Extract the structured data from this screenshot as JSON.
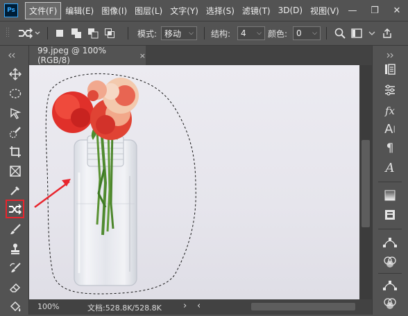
{
  "menubar": {
    "logo": "Ps",
    "items": [
      "文件(F)",
      "编辑(E)",
      "图像(I)",
      "图层(L)",
      "文字(Y)",
      "选择(S)",
      "滤镜(T)",
      "3D(D)",
      "视图(V)"
    ],
    "active_index": 0
  },
  "window_controls": {
    "minimize": "—",
    "restore": "❐",
    "close": "✕"
  },
  "options": {
    "mode_label": "模式:",
    "mode_value": "移动",
    "structure_label": "结构:",
    "structure_value": "4",
    "color_label": "颜色:",
    "color_value": "0"
  },
  "document": {
    "tab_title": "99.jpeg @ 100%(RGB/8)",
    "close": "×"
  },
  "status": {
    "zoom": "100%",
    "doc_info": "文档:528.8K/528.8K",
    "next": "›",
    "prev": "‹"
  },
  "colors": {
    "panel_bg": "#535353",
    "dark_bg": "#424242",
    "accent_red": "#e8252d",
    "ps_blue": "#31a8ff"
  },
  "tools_left": [
    "move-tool",
    "marquee-tool",
    "lasso-tool",
    "quick-selection-tool",
    "crop-tool",
    "frame-tool",
    "eyedropper-tool",
    "content-aware-move-tool",
    "brush-tool",
    "clone-stamp-tool",
    "history-brush-tool",
    "eraser-tool",
    "paint-bucket-tool",
    "blur-tool"
  ],
  "panels_right": [
    "history-icon",
    "adjustments-icon",
    "fx-styles-icon",
    "character-icon",
    "paragraph-icon",
    "glyphs-icon",
    "gradient-icon",
    "libraries-icon",
    "paths-icon",
    "channels-icon",
    "paths2-icon",
    "channels2-icon"
  ]
}
